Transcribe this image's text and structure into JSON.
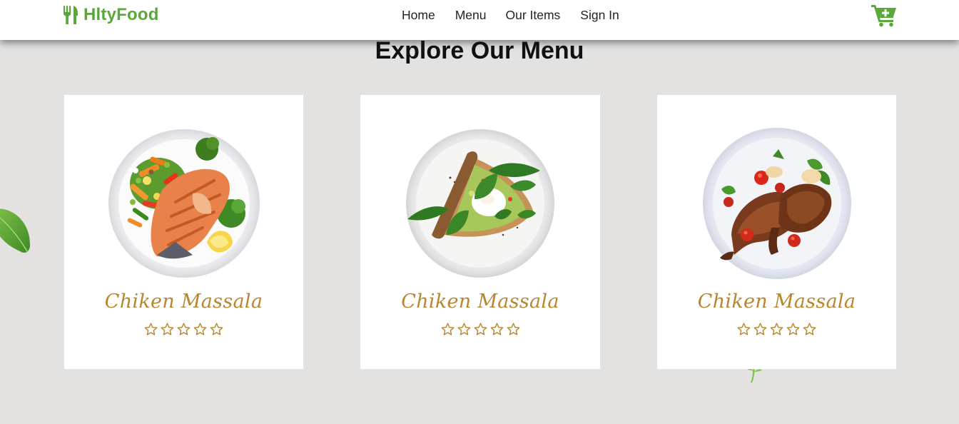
{
  "brand": {
    "name": "HltyFood",
    "icon": "utensils-icon",
    "color": "#5aa83a"
  },
  "nav": {
    "links": [
      {
        "label": "Home"
      },
      {
        "label": "Menu"
      },
      {
        "label": "Our Items"
      },
      {
        "label": "Sign In"
      }
    ],
    "cart_icon": "cart-plus-icon"
  },
  "main": {
    "title": "Explore Our Menu"
  },
  "cards": [
    {
      "name": "Chiken Massala",
      "rating": 0,
      "rating_max": 5,
      "dish": "grilled salmon with vegetables"
    },
    {
      "name": "Chiken Massala",
      "rating": 0,
      "rating_max": 5,
      "dish": "avocado toast with spinach and poached egg"
    },
    {
      "name": "Chiken Massala",
      "rating": 0,
      "rating_max": 5,
      "dish": "roasted duck legs with tomatoes"
    }
  ],
  "colors": {
    "accent": "#5aa83a",
    "dish_name": "#b8862d",
    "background": "#e3e2e1"
  }
}
